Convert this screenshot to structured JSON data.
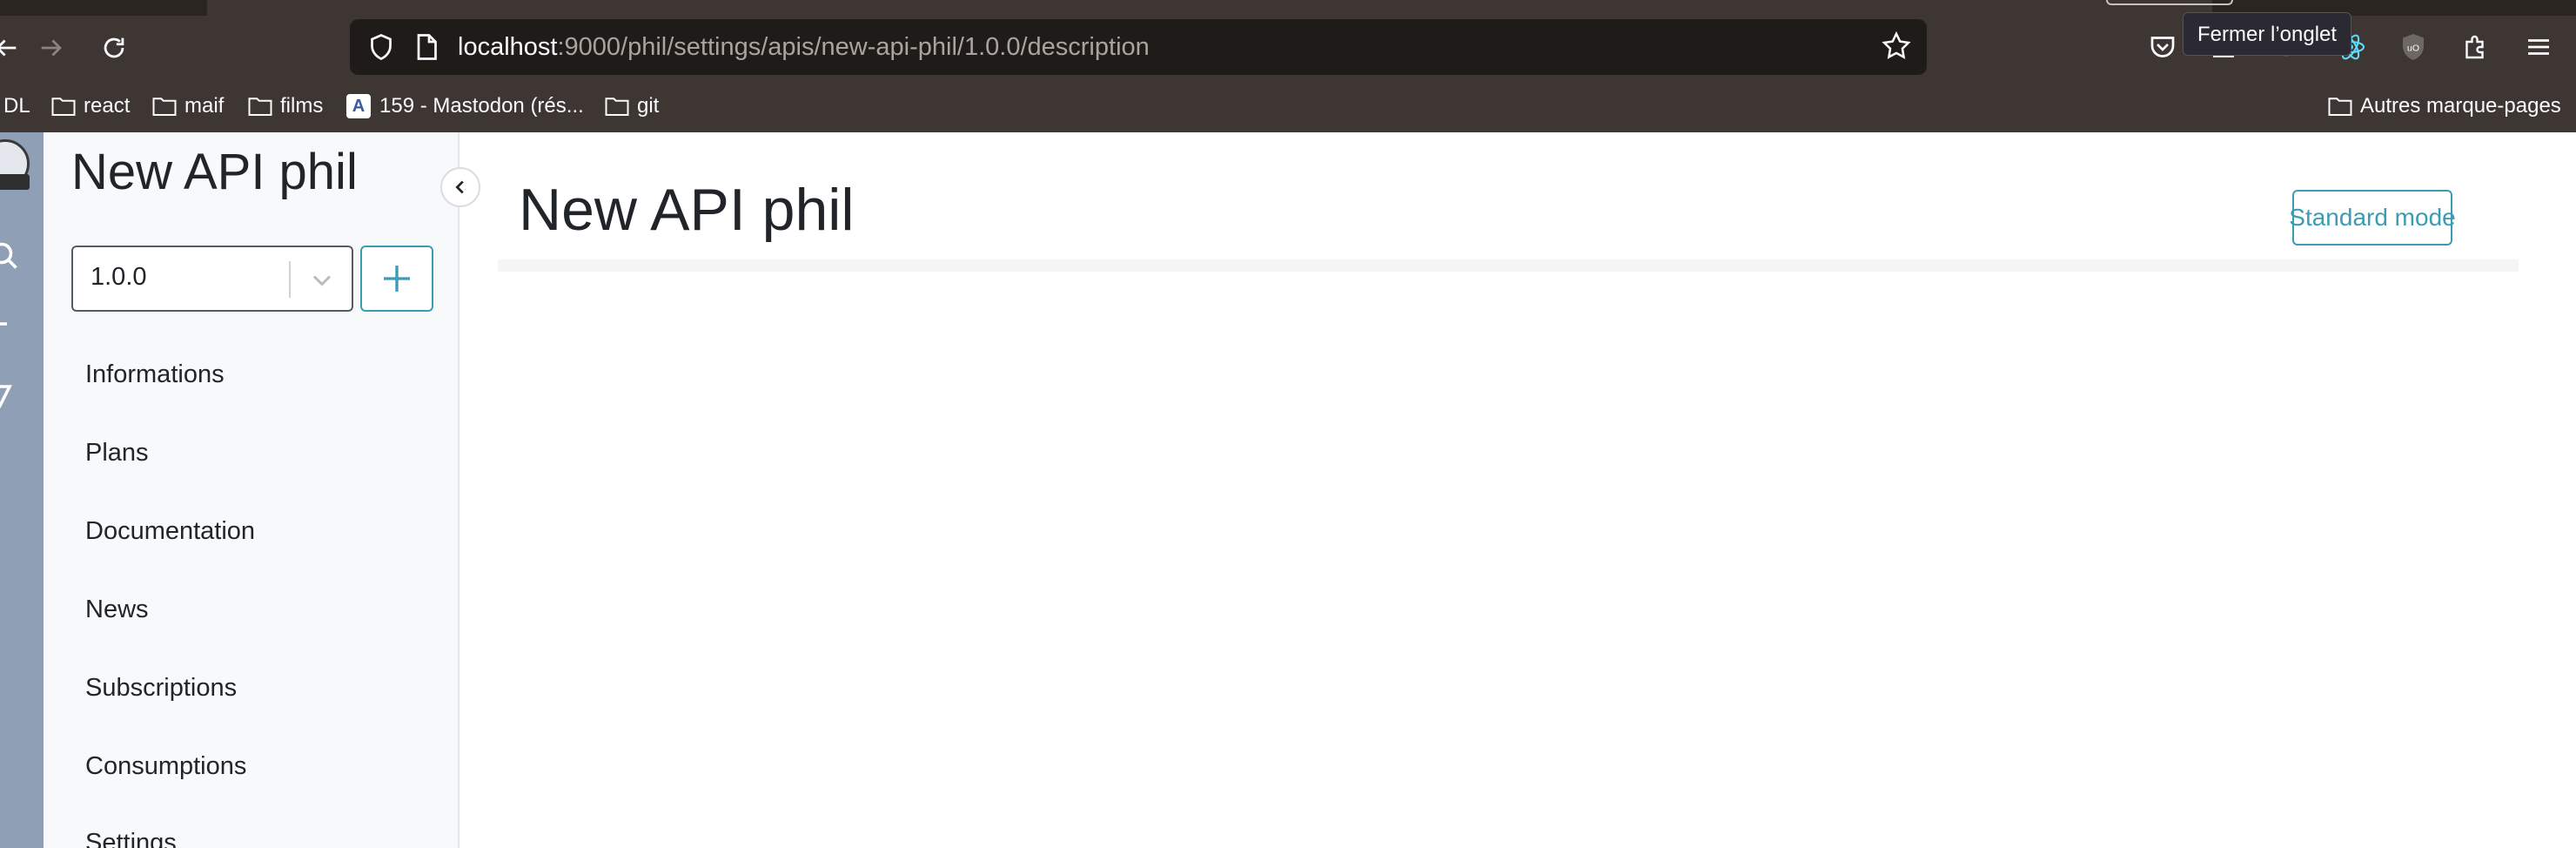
{
  "browser": {
    "url_host": "localhost",
    "url_path": ":9000/phil/settings/apis/new-api-phil/1.0.0/description",
    "tooltip": "Fermer l’onglet",
    "bookmarks": [
      {
        "label": "DL",
        "icon": "none"
      },
      {
        "label": "react",
        "icon": "folder-icon"
      },
      {
        "label": "maif",
        "icon": "folder-icon"
      },
      {
        "label": "films",
        "icon": "folder-icon"
      },
      {
        "label": "159 - Mastodon (rés...",
        "icon": "mastodon-favicon"
      },
      {
        "label": "git",
        "icon": "folder-icon"
      }
    ],
    "other_bookmarks": "Autres marque-pages"
  },
  "sidebar": {
    "title": "New API phil",
    "version": "1.0.0",
    "items": [
      {
        "label": "Informations"
      },
      {
        "label": "Plans"
      },
      {
        "label": "Documentation"
      },
      {
        "label": "News"
      },
      {
        "label": "Subscriptions"
      },
      {
        "label": "Consumptions"
      },
      {
        "label": "Settings"
      }
    ]
  },
  "main": {
    "title": "New API phil",
    "mode_button": "Standard mode"
  },
  "colors": {
    "accent": "#3a9cb5",
    "chrome_bg": "#3d3632",
    "rail_bg": "#8fa0b6",
    "sidebar_bg": "#f7f9fb"
  }
}
